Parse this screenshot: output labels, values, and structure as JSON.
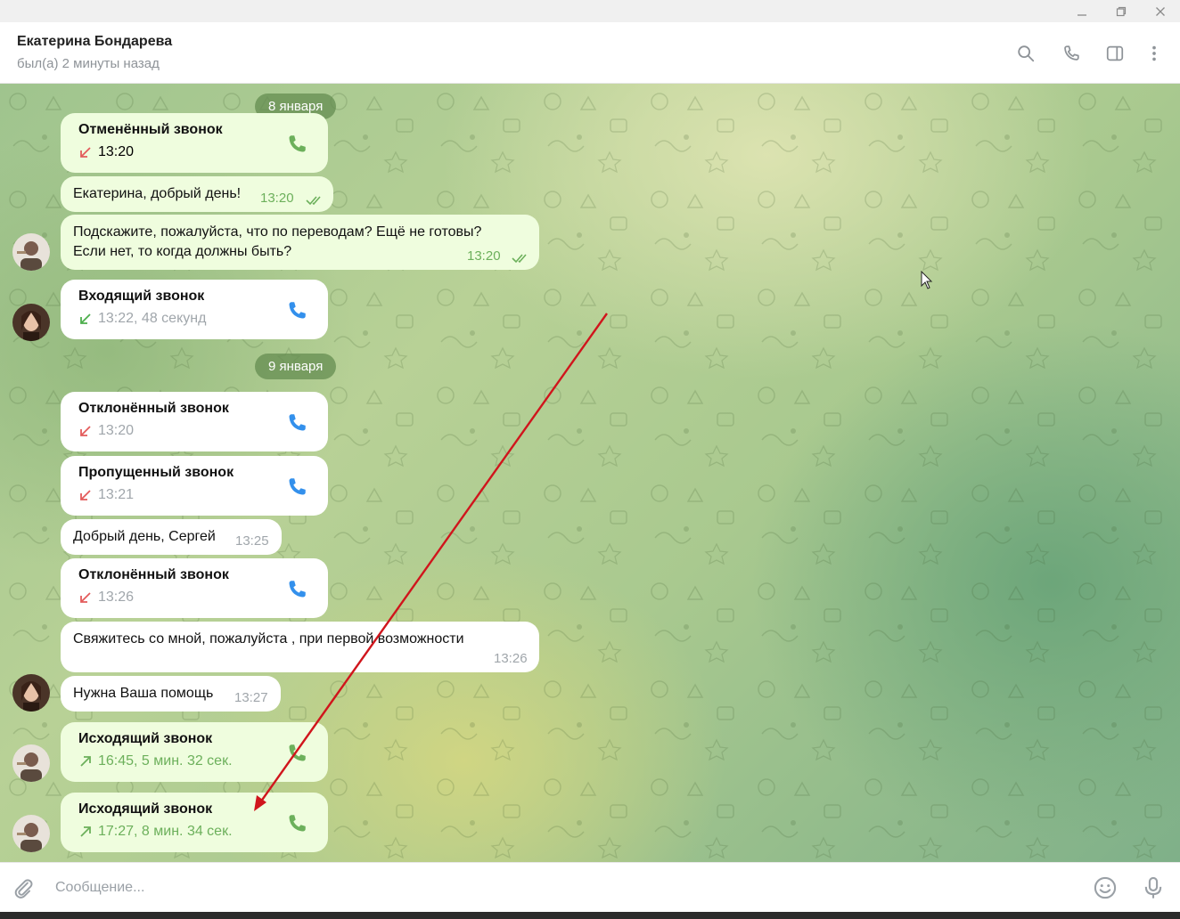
{
  "header": {
    "name": "Екатерина Бондарева",
    "status": "был(а) 2 минуты назад",
    "icons": [
      "search-icon",
      "phone-icon",
      "sidebar-icon",
      "more-vertical-icon"
    ]
  },
  "window": {
    "controls": [
      "minimize-icon",
      "restore-icon",
      "close-icon"
    ]
  },
  "colors": {
    "outgoing_bubble": "#effdde",
    "incoming_bubble": "#ffffff",
    "accent": "#6cb05b",
    "call_phone": "#3390ec",
    "missed_red": "#e35b5b",
    "annotation_arrow": "#d0151c"
  },
  "dates": [
    "8 января",
    "9 января"
  ],
  "messages": {
    "m1": {
      "type": "call",
      "title": "Отменённый звонок",
      "detail": "13:20",
      "direction": "missed"
    },
    "m2": {
      "type": "text",
      "text": "Екатерина, добрый день!",
      "time": "13:20",
      "read": true
    },
    "m3": {
      "type": "text",
      "line1": "Подскажите, пожалуйста, что по переводам? Ещё не готовы?",
      "line2": "Если нет, то когда должны быть?",
      "time": "13:20",
      "read": true
    },
    "m4": {
      "type": "call",
      "title": "Входящий звонок",
      "detail": "13:22, 48 секунд",
      "direction": "incoming"
    },
    "m5": {
      "type": "call",
      "title": "Отклонённый звонок",
      "detail": "13:20",
      "direction": "missed"
    },
    "m6": {
      "type": "call",
      "title": "Пропущенный звонок",
      "detail": "13:21",
      "direction": "missed"
    },
    "m7": {
      "type": "text",
      "text": "Добрый день, Сергей",
      "time": "13:25"
    },
    "m8": {
      "type": "call",
      "title": "Отклонённый звонок",
      "detail": "13:26",
      "direction": "missed"
    },
    "m9": {
      "type": "text",
      "text": "Свяжитесь со мной, пожалуйста , при первой возможности",
      "time": "13:26"
    },
    "m10": {
      "type": "text",
      "text": "Нужна Ваша помощь",
      "time": "13:27"
    },
    "m11": {
      "type": "call",
      "title": "Исходящий звонок",
      "detail": "16:45, 5 мин. 32 сек.",
      "direction": "outgoing"
    },
    "m12": {
      "type": "call",
      "title": "Исходящий звонок",
      "detail": "17:27, 8 мин. 34 сек.",
      "direction": "outgoing"
    }
  },
  "compose": {
    "placeholder": "Сообщение...",
    "icons": [
      "attach-icon",
      "emoji-icon",
      "microphone-icon"
    ]
  }
}
